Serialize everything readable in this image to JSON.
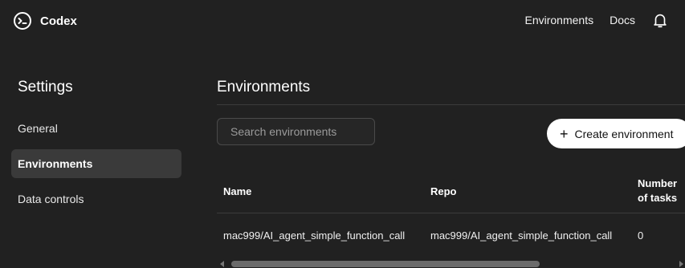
{
  "app": {
    "name": "Codex"
  },
  "topnav": {
    "environments_label": "Environments",
    "docs_label": "Docs",
    "notifications_icon": "bell-icon"
  },
  "sidebar": {
    "title": "Settings",
    "items": [
      {
        "label": "General",
        "active": false
      },
      {
        "label": "Environments",
        "active": true
      },
      {
        "label": "Data controls",
        "active": false
      }
    ]
  },
  "main": {
    "title": "Environments",
    "search": {
      "placeholder": "Search environments",
      "value": ""
    },
    "create_button": {
      "label": "Create environment",
      "icon": "plus-icon"
    },
    "table": {
      "columns": [
        {
          "label": "Name"
        },
        {
          "label": "Repo"
        },
        {
          "label_line1": "Number",
          "label_line2": "of tasks"
        }
      ],
      "rows": [
        {
          "name": "mac999/AI_agent_simple_function_call",
          "repo": "mac999/AI_agent_simple_function_call",
          "tasks": "0"
        }
      ]
    }
  },
  "colors": {
    "background": "#212121",
    "active_item": "#3a3a3a",
    "button_bg": "#ffffff",
    "text": "#ffffff"
  }
}
